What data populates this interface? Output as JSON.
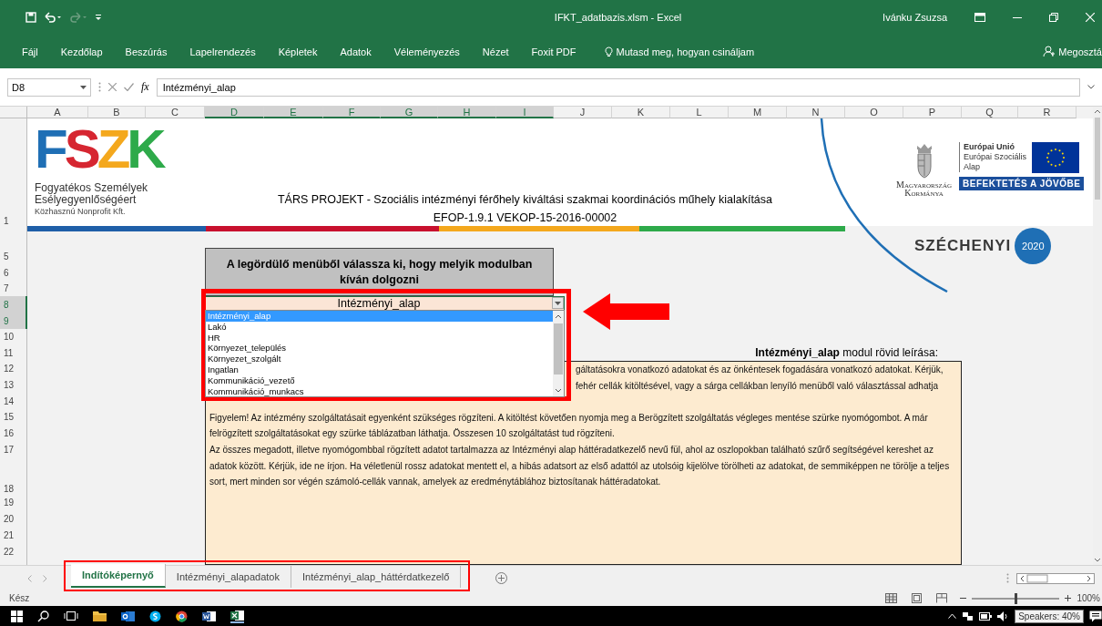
{
  "window": {
    "title": "IFKT_adatbazis.xlsm - Excel",
    "user": "Ivánku Zsuzsa"
  },
  "ribbon": {
    "tabs": [
      "Fájl",
      "Kezdőlap",
      "Beszúrás",
      "Lapelrendezés",
      "Képletek",
      "Adatok",
      "Véleményezés",
      "Nézet",
      "Foxit PDF"
    ],
    "tell_me": "Mutasd meg, hogyan csináljam",
    "share": "Megosztá"
  },
  "formula_bar": {
    "name_box": "D8",
    "function_label": "fx",
    "formula": "Intézményi_alap"
  },
  "columns": [
    {
      "label": "A",
      "selected": false
    },
    {
      "label": "B",
      "selected": false
    },
    {
      "label": "C",
      "selected": false
    },
    {
      "label": "D",
      "selected": true
    },
    {
      "label": "E",
      "selected": true
    },
    {
      "label": "F",
      "selected": true
    },
    {
      "label": "G",
      "selected": true
    },
    {
      "label": "H",
      "selected": true
    },
    {
      "label": "I",
      "selected": true
    },
    {
      "label": "J",
      "selected": false
    },
    {
      "label": "K",
      "selected": false
    },
    {
      "label": "L",
      "selected": false
    },
    {
      "label": "M",
      "selected": false
    },
    {
      "label": "N",
      "selected": false
    },
    {
      "label": "O",
      "selected": false
    },
    {
      "label": "P",
      "selected": false
    },
    {
      "label": "Q",
      "selected": false
    },
    {
      "label": "R",
      "selected": false
    }
  ],
  "rows": [
    {
      "label": "1",
      "selected": false
    },
    {
      "label": "5",
      "selected": false
    },
    {
      "label": "6",
      "selected": false
    },
    {
      "label": "7",
      "selected": false
    },
    {
      "label": "8",
      "selected": true
    },
    {
      "label": "9",
      "selected": true
    },
    {
      "label": "10",
      "selected": false
    },
    {
      "label": "11",
      "selected": false
    },
    {
      "label": "12",
      "selected": false
    },
    {
      "label": "13",
      "selected": false
    },
    {
      "label": "14",
      "selected": false
    },
    {
      "label": "15",
      "selected": false
    },
    {
      "label": "16",
      "selected": false
    },
    {
      "label": "17",
      "selected": false
    },
    {
      "label": "18",
      "selected": false
    },
    {
      "label": "19",
      "selected": false
    },
    {
      "label": "20",
      "selected": false
    },
    {
      "label": "21",
      "selected": false
    },
    {
      "label": "22",
      "selected": false
    }
  ],
  "header": {
    "logo_letters": [
      {
        "text": "F",
        "color": "#1f6fb5"
      },
      {
        "text": "S",
        "color": "#d62631"
      },
      {
        "text": "Z",
        "color": "#f4a81d"
      },
      {
        "text": "K",
        "color": "#2eaa4a"
      }
    ],
    "org_name": [
      "Fogyatékos Személyek",
      "Esélyegyenlőségéert"
    ],
    "org_type": "Közhasznú Nonprofit Kft.",
    "project_title": "TÁRS PROJEKT - Szociális intézményi férőhely kiváltási szakmai koordinációs műhely kialakítása",
    "project_code": "EFOP-1.9.1 VEKOP-15-2016-00002",
    "government": [
      "Magyarország",
      "Kormánya"
    ],
    "eu_title": "Európai Unió",
    "eu_lines": [
      "Európai Szociális",
      "Alap"
    ],
    "eu_banner": "BEFEKTETÉS A JÖVŐBE",
    "szechenyi": "SZÉCHENYI",
    "szechenyi_year": "2020"
  },
  "prompt": "A legördülő menüből válassza ki, hogy melyik modulban kíván dolgozni",
  "dropdown": {
    "value": "Intézményi_alap",
    "options": [
      {
        "label": "Intézményi_alap",
        "selected": true
      },
      {
        "label": "Lakó",
        "selected": false
      },
      {
        "label": "HR",
        "selected": false
      },
      {
        "label": "Környezet_település",
        "selected": false
      },
      {
        "label": "Környezet_szolgált",
        "selected": false
      },
      {
        "label": "Ingatlan",
        "selected": false
      },
      {
        "label": "Kommunikáció_vezető",
        "selected": false
      },
      {
        "label": "Kommunikáció_munkacs",
        "selected": false
      }
    ]
  },
  "description": {
    "heading": "**Intézményi_alap** modul rövid leírása:",
    "covered_lines": [
      "gáltatásokra vonatkozó adatokat és az önkéntesek fogadására vonatkozó adatokat. Kérjük,",
      "fehér cellák kitöltésével, vagy a sárga cellákban lenyíló menüből való választással adhatja"
    ],
    "paragraphs": [
      "Figyelem! Az intézmény szolgáltatásait egyenként szükséges rögzíteni. A kitöltést követően nyomja meg a Berögzített szolgáltatás végleges mentése szürke nyomógombot. A már felrögzített szolgáltatásokat egy szürke táblázatban láthatja. Összesen 10 szolgáltatást tud rögzíteni.",
      "Az összes megadott, illetve nyomógombbal rögzített adatot tartalmazza az Intézményi alap háttéradatkezelő nevű fül, ahol az oszlopokban található szűrő segítségével kereshet az adatok között. Kérjük, ide ne írjon. Ha véletlenül rossz adatokat mentett el, a hibás adatsort az első adattól az utolsóig kijelölve törölheti az adatokat, de semmiképpen ne törölje a teljes sort, mert minden sor végén számoló-cellák vannak, amelyek az eredménytáblához biztosítanak háttéradatokat."
    ]
  },
  "sheet_tabs": [
    {
      "label": "Indítóképernyő",
      "selected": true
    },
    {
      "label": "Intézményi_alapadatok",
      "selected": false
    },
    {
      "label": "Intézményi_alap_háttérdatkezelő",
      "selected": false
    }
  ],
  "status_bar": {
    "status": "Kész",
    "zoom": {
      "level": 0.5,
      "reading": "100%"
    }
  },
  "taskbar": {
    "tooltip": "Speakers: 40%"
  }
}
